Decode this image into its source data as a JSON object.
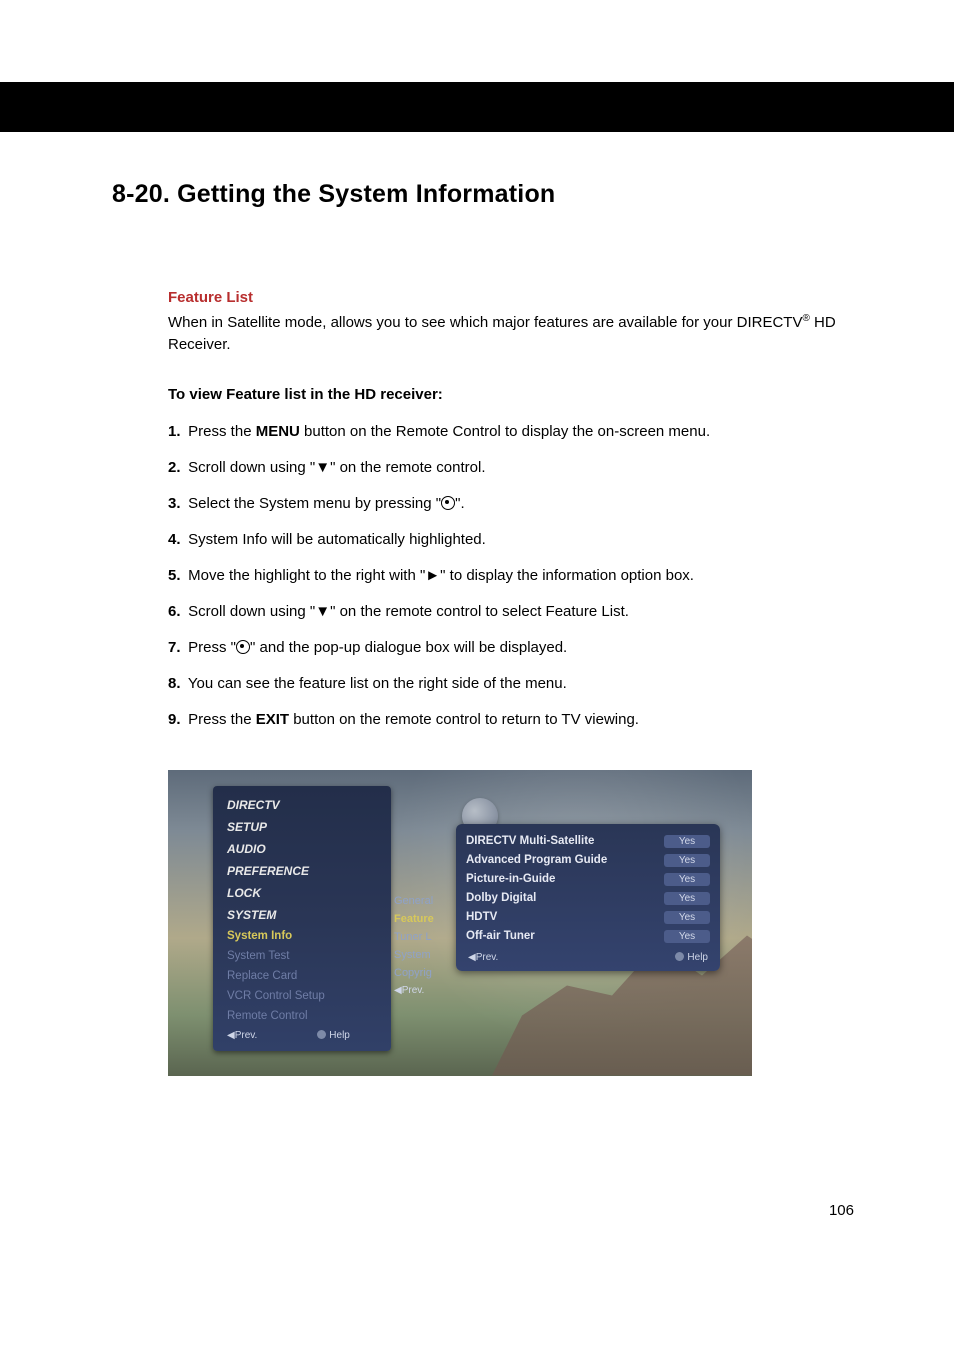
{
  "section_title": "8-20. Getting the System Information",
  "feature_list": {
    "heading": "Feature List",
    "para_a": "When in Satellite mode, allows you to see which major features are available for your DIRECTV",
    "reg": "®",
    "para_b": " HD Receiver."
  },
  "instructions_heading": "To view Feature list in the HD receiver:",
  "steps": {
    "s1": {
      "num": "1.",
      "a": "Press the ",
      "kw": "MENU",
      "b": " button on the Remote Control to display the on-screen menu."
    },
    "s2": {
      "num": "2.",
      "a": "Scroll down using \"",
      "sym": "▼",
      "b": "\" on the remote control."
    },
    "s3": {
      "num": "3.",
      "a": "Select the System menu by pressing \"",
      "b": "\"."
    },
    "s4": {
      "num": "4.",
      "a": "System Info will be automatically highlighted."
    },
    "s5": {
      "num": "5.",
      "a": "Move the highlight to the right with \"",
      "sym": "►",
      "b": "\" to display the information option box."
    },
    "s6": {
      "num": "6.",
      "a": "Scroll down using \"",
      "sym": "▼",
      "b": "\" on the remote control to select Feature List."
    },
    "s7": {
      "num": "7.",
      "a": "Press \"",
      "b": "\" and the pop-up dialogue box will be displayed."
    },
    "s8": {
      "num": "8.",
      "a": "You can see the feature list on the right side of the menu."
    },
    "s9": {
      "num": "9.",
      "a": "Press the ",
      "kw": "EXIT",
      "b": " button on the remote control to return to TV viewing."
    }
  },
  "osd": {
    "menu": {
      "items": [
        "DIRECTV",
        "SETUP",
        "AUDIO",
        "PREFERENCE",
        "LOCK",
        "SYSTEM"
      ],
      "subitems": {
        "info": "System Info",
        "test": "System Test",
        "replace": "Replace Card",
        "vcr": "VCR Control Setup",
        "remote": "Remote Control"
      },
      "prev": "◀Prev.",
      "help": "Help"
    },
    "options": {
      "general": "General",
      "feature": "Feature",
      "tuner": "Tuner L",
      "system": "System",
      "copyrig": "Copyrig",
      "prev": "◀Prev."
    },
    "features": {
      "rows": [
        {
          "name": "DIRECTV Multi-Satellite",
          "val": "Yes"
        },
        {
          "name": "Advanced Program Guide",
          "val": "Yes"
        },
        {
          "name": "Picture-in-Guide",
          "val": "Yes"
        },
        {
          "name": "Dolby Digital",
          "val": "Yes"
        },
        {
          "name": "HDTV",
          "val": "Yes"
        },
        {
          "name": "Off-air Tuner",
          "val": "Yes"
        }
      ],
      "prev": "◀Prev.",
      "help": "Help"
    }
  },
  "page_number": "106"
}
